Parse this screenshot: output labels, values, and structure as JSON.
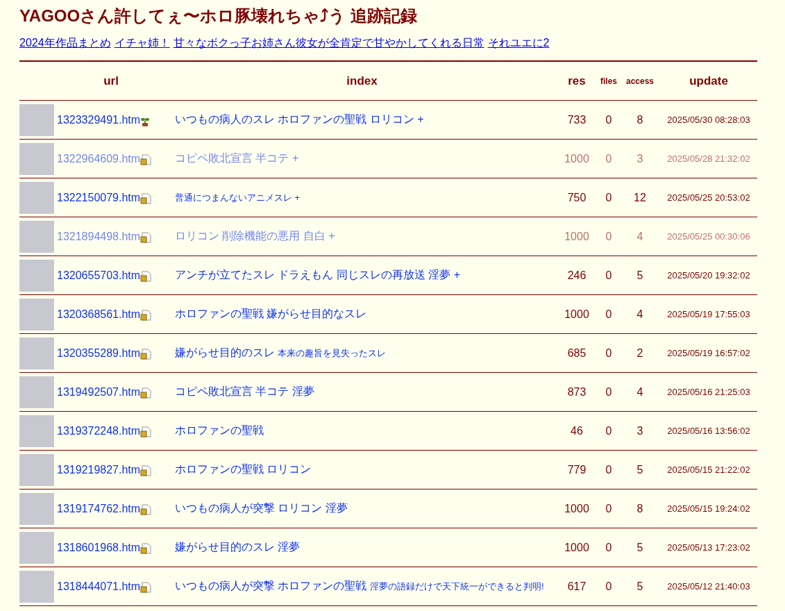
{
  "title": "YAGOOさん許してぇ〜ホロ豚壊れちゃ⤴う 追跡記録",
  "links": [
    "2024年作品まとめ",
    "イチャ姉！",
    "甘々なボクっ子お姉さん彼女が全肯定で甘やかしてくれる日常",
    "それユエに2"
  ],
  "columns": [
    "url",
    "index",
    "res",
    "files",
    "access",
    "update"
  ],
  "rows": [
    {
      "url": "1323329491.htm",
      "kind": "new",
      "faded": false,
      "index": [
        {
          "text": "いつもの病人のスレ ホロファンの聖戦 ロリコン +",
          "small": false
        }
      ],
      "res": "733",
      "files": "0",
      "access": "8",
      "update": "2025/05/30 08:28:03"
    },
    {
      "url": "1322964609.htm",
      "kind": "archived",
      "faded": true,
      "index": [
        {
          "text": "コピペ敗北宣言 半コテ +",
          "small": false
        }
      ],
      "res": "1000",
      "files": "0",
      "access": "3",
      "update": "2025/05/28 21:32:02"
    },
    {
      "url": "1322150079.htm",
      "kind": "archived",
      "faded": false,
      "index": [
        {
          "text": "普通につまんないアニメスレ +",
          "small": true
        }
      ],
      "res": "750",
      "files": "0",
      "access": "12",
      "update": "2025/05/25 20:53:02"
    },
    {
      "url": "1321894498.htm",
      "kind": "archived",
      "faded": true,
      "index": [
        {
          "text": "ロリコン 削除機能の悪用 自白 +",
          "small": false
        }
      ],
      "res": "1000",
      "files": "0",
      "access": "4",
      "update": "2025/05/25 00:30:06"
    },
    {
      "url": "1320655703.htm",
      "kind": "archived",
      "faded": false,
      "index": [
        {
          "text": "アンチが立てたスレ ドラえもん 同じスレの再放送 淫夢 +",
          "small": false
        }
      ],
      "res": "246",
      "files": "0",
      "access": "5",
      "update": "2025/05/20 19:32:02"
    },
    {
      "url": "1320368561.htm",
      "kind": "archived",
      "faded": false,
      "index": [
        {
          "text": "ホロファンの聖戦 嫌がらせ目的なスレ",
          "small": false
        }
      ],
      "res": "1000",
      "files": "0",
      "access": "4",
      "update": "2025/05/19 17:55:03"
    },
    {
      "url": "1320355289.htm",
      "kind": "archived",
      "faded": false,
      "index": [
        {
          "text": "嫌がらせ目的のスレ",
          "small": false
        },
        {
          "text": "本来の趣旨を見失ったスレ",
          "small": true
        }
      ],
      "res": "685",
      "files": "0",
      "access": "2",
      "update": "2025/05/19 16:57:02"
    },
    {
      "url": "1319492507.htm",
      "kind": "archived",
      "faded": false,
      "index": [
        {
          "text": "コピペ敗北宣言 半コテ 淫夢",
          "small": false
        }
      ],
      "res": "873",
      "files": "0",
      "access": "4",
      "update": "2025/05/16 21:25:03"
    },
    {
      "url": "1319372248.htm",
      "kind": "archived",
      "faded": false,
      "index": [
        {
          "text": "ホロファンの聖戦",
          "small": false
        }
      ],
      "res": "46",
      "files": "0",
      "access": "3",
      "update": "2025/05/16 13:56:02"
    },
    {
      "url": "1319219827.htm",
      "kind": "archived",
      "faded": false,
      "index": [
        {
          "text": "ホロファンの聖戦 ロリコン",
          "small": false
        }
      ],
      "res": "779",
      "files": "0",
      "access": "5",
      "update": "2025/05/15 21:22:02"
    },
    {
      "url": "1319174762.htm",
      "kind": "archived",
      "faded": false,
      "index": [
        {
          "text": "いつもの病人が突撃 ロリコン 淫夢",
          "small": false
        }
      ],
      "res": "1000",
      "files": "0",
      "access": "8",
      "update": "2025/05/15 19:24:02"
    },
    {
      "url": "1318601968.htm",
      "kind": "archived",
      "faded": false,
      "index": [
        {
          "text": "嫌がらせ目的のスレ 淫夢",
          "small": false
        }
      ],
      "res": "1000",
      "files": "0",
      "access": "5",
      "update": "2025/05/13 17:23:02"
    },
    {
      "url": "1318444071.htm",
      "kind": "archived",
      "faded": false,
      "index": [
        {
          "text": "いつもの病人が突撃 ホロファンの聖戦",
          "small": false
        },
        {
          "text": "淫夢の語録だけで天下統一ができると判明!",
          "small": true
        }
      ],
      "res": "617",
      "files": "0",
      "access": "5",
      "update": "2025/05/12 21:40:03"
    }
  ]
}
